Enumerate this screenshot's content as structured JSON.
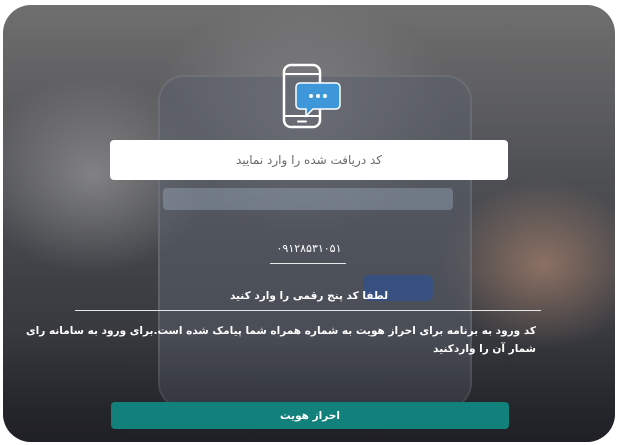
{
  "verification": {
    "icon": "phone-message-icon",
    "code_placeholder": "کد دریافت شده را وارد نمایید",
    "phone_number": "۰۹۱۲۸۵۳۱۰۵۱",
    "instruction": "لطفا کد پنج رقمی را وارد کنید",
    "description": "کد ورود به برنامه برای احراز هویت به شماره همراه شما پیامک شده است.برای ورود به سامانه رای شمار آن را واردکنید",
    "submit_label": "احراز هویت"
  },
  "colors": {
    "accent": "#12807b",
    "icon_blue": "#3d97d8"
  }
}
